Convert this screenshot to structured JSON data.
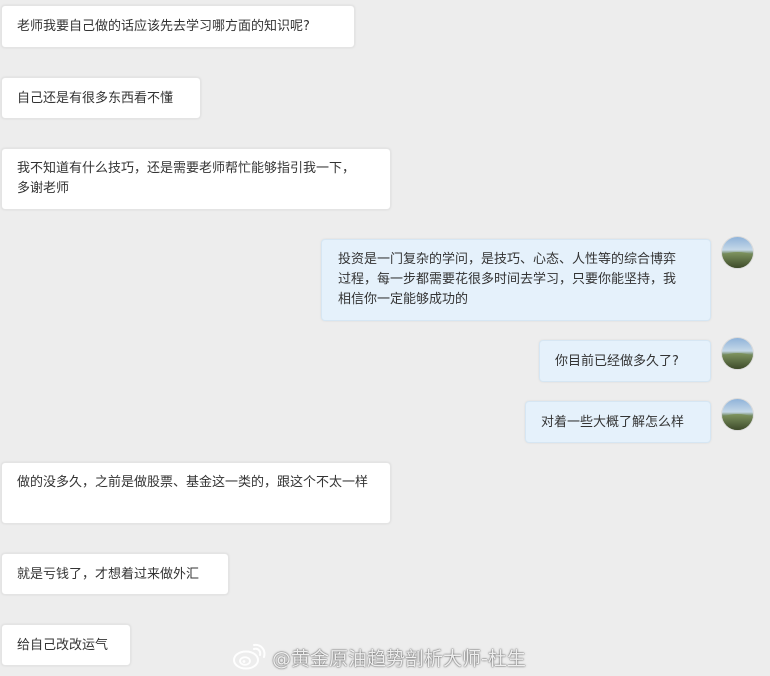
{
  "chat": {
    "messages": [
      {
        "side": "in",
        "text": "老师我要自己做的话应该先去学习哪方面的知识呢?"
      },
      {
        "side": "in",
        "text": "自己还是有很多东西看不懂"
      },
      {
        "side": "in",
        "text": "我不知道有什么技巧，还是需要老师帮忙能够指引我一下，多谢老师"
      },
      {
        "side": "out",
        "text": "投资是一门复杂的学问，是技巧、心态、人性等的综合博弈过程，每一步都需要花很多时间去学习，只要你能坚持，我相信你一定能够成功的"
      },
      {
        "side": "out",
        "text": "你目前已经做多久了?"
      },
      {
        "side": "out",
        "text": "对着一些大概了解怎么样"
      },
      {
        "side": "in",
        "text": "做的没多久，之前是做股票、基金这一类的，跟这个不太一样"
      },
      {
        "side": "in",
        "text": "就是亏钱了，才想着过来做外汇"
      },
      {
        "side": "in",
        "text": "给自己改改运气"
      }
    ]
  },
  "watermark": {
    "text": "@黄金原油趋势剖析大师-杜生",
    "icon": "weibo-icon"
  },
  "colors": {
    "background": "#ededed",
    "incoming_bubble": "#ffffff",
    "outgoing_bubble": "#e5f1fb",
    "text": "#333333"
  }
}
